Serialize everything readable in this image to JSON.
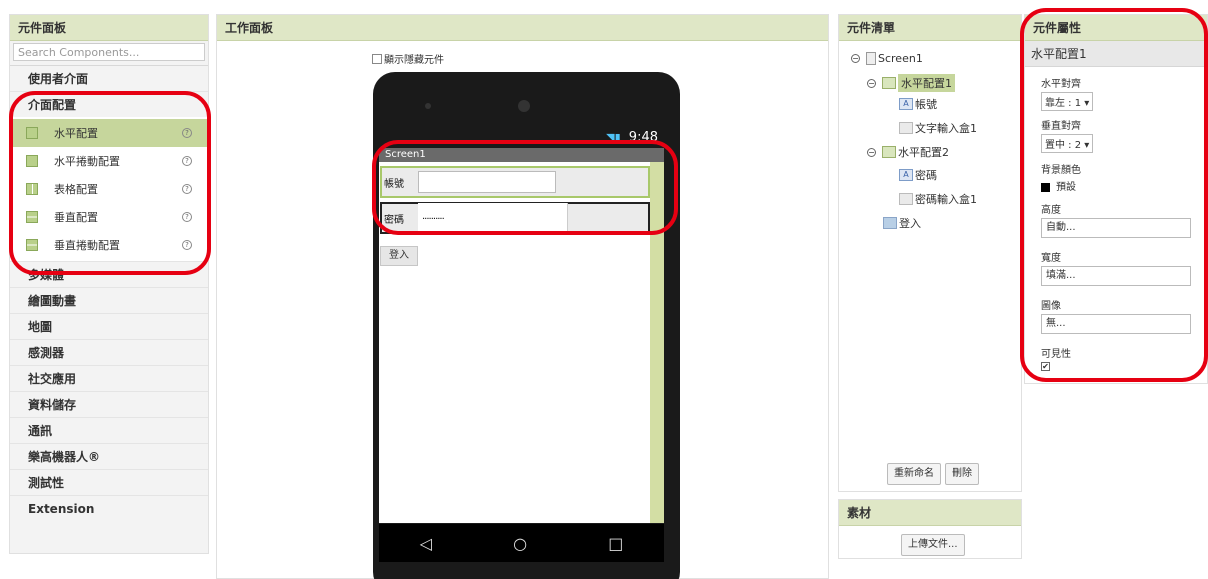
{
  "palette": {
    "title": "元件面板",
    "search_placeholder": "Search Components...",
    "categories_top": [
      "使用者介面",
      "介面配置"
    ],
    "layout_items": [
      "水平配置",
      "水平捲動配置",
      "表格配置",
      "垂直配置",
      "垂直捲動配置"
    ],
    "categories_bottom": [
      "多媒體",
      "繪圖動畫",
      "地圖",
      "感測器",
      "社交應用",
      "資料儲存",
      "通訊",
      "樂高機器人®",
      "測試性",
      "Extension"
    ]
  },
  "viewer": {
    "title": "工作面板",
    "show_hidden_label": "顯示隱藏元件",
    "status_time": "9:48",
    "screen_title": "Screen1",
    "row1_label": "帳號",
    "row1_value": "",
    "row2_label": "密碼",
    "row2_value": "..........",
    "login_button": "登入",
    "nav_back": "◁",
    "nav_home": "○",
    "nav_recent": "□"
  },
  "tree": {
    "title": "元件清單",
    "nodes": {
      "screen": "Screen1",
      "h1": "水平配置1",
      "h1_label": "帳號",
      "h1_text": "文字輸入盒1",
      "h2": "水平配置2",
      "h2_label": "密碼",
      "h2_pwd": "密碼輸入盒1",
      "btn": "登入"
    },
    "rename_button": "重新命名",
    "delete_button": "刪除"
  },
  "media": {
    "title": "素材",
    "upload_button": "上傳文件..."
  },
  "props": {
    "title": "元件屬性",
    "component": "水平配置1",
    "align_h_label": "水平對齊",
    "align_h_value": "靠左 : 1 ▾",
    "align_v_label": "垂直對齊",
    "align_v_value": "置中 : 2 ▾",
    "bg_label": "背景顏色",
    "bg_value": "預設",
    "height_label": "高度",
    "height_value": "自動...",
    "width_label": "寬度",
    "width_value": "填滿...",
    "image_label": "圖像",
    "image_value": "無...",
    "visible_label": "可見性",
    "visible_checked": true
  },
  "colors": {
    "annotation": "#e60012",
    "selection": "#c6d69c",
    "header": "#dfe7c6"
  }
}
